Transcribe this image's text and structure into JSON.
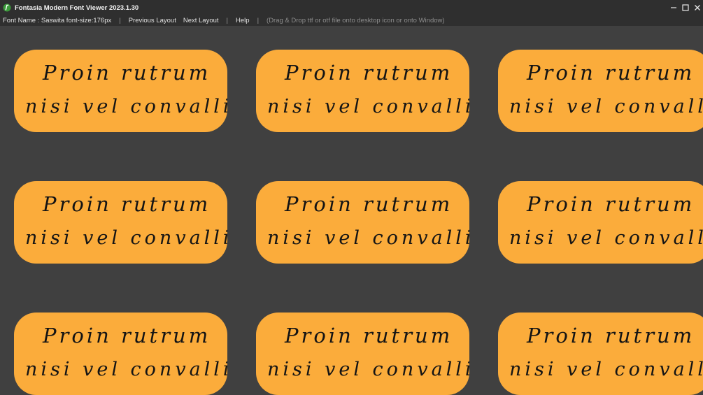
{
  "window": {
    "title": "Fontasia Modern Font Viewer 2023.1.30",
    "app_icon": "fontasia-logo-icon",
    "controls": {
      "minimize_glyph": "—",
      "maximize_glyph": "☐",
      "close_glyph": "✕"
    }
  },
  "menubar": {
    "font_info": "Font Name : Saswita font-size:176px",
    "separator": "|",
    "previous_layout": "Previous Layout",
    "next_layout": "Next Layout",
    "help": "Help",
    "hint": "(Drag & Drop ttf or otf file onto desktop icon or onto Window)"
  },
  "preview": {
    "line1": "Proin rutrum",
    "line2": "nisi vel convallis",
    "card_color": "#fbac3b",
    "background_color": "#404040",
    "text_color": "#141414"
  }
}
